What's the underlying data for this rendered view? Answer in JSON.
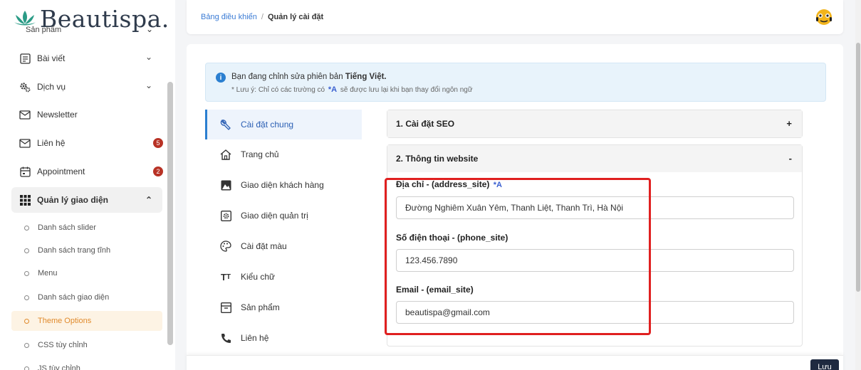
{
  "sidebar": {
    "logo_text": "Beautispa.",
    "partial_item": "Sản phẩm",
    "items": [
      {
        "label": "Bài viết",
        "icon": "article-icon"
      },
      {
        "label": "Dịch vụ",
        "icon": "gears-icon"
      },
      {
        "label": "Newsletter",
        "icon": "mail-icon"
      },
      {
        "label": "Liên hệ",
        "icon": "mail-icon",
        "badge": "5"
      },
      {
        "label": "Appointment",
        "icon": "calendar-icon",
        "badge": "2"
      },
      {
        "label": "Quản lý giao diện",
        "icon": "grid-icon"
      }
    ],
    "sub_items": [
      {
        "label": "Danh sách slider"
      },
      {
        "label": "Danh sách trang tĩnh"
      },
      {
        "label": "Menu"
      },
      {
        "label": "Danh sách giao diện"
      },
      {
        "label": "Theme Options"
      },
      {
        "label": "CSS tùy chỉnh"
      },
      {
        "label": "JS tùy chỉnh"
      }
    ]
  },
  "breadcrumb": {
    "parent": "Bảng điều khiển",
    "separator": "/",
    "current": "Quản lý cài đặt"
  },
  "notice": {
    "line1_prefix": "Bạn đang chỉnh sửa phiên bản",
    "line1_lang": "Tiếng Việt.",
    "line2_prefix": "* Lưu ý: Chỉ có các trường có",
    "line2_suffix": "sẽ được lưu lại khi bạn thay đổi ngôn ngữ"
  },
  "settings_tabs": [
    {
      "label": "Cài đặt chung",
      "icon": "wrench-icon"
    },
    {
      "label": "Trang chủ",
      "icon": "home-icon"
    },
    {
      "label": "Giao diện khách hàng",
      "icon": "image-icon"
    },
    {
      "label": "Giao diện quản trị",
      "icon": "dashboard-icon"
    },
    {
      "label": "Cài đặt màu",
      "icon": "palette-icon"
    },
    {
      "label": "Kiểu chữ",
      "icon": "text-icon"
    },
    {
      "label": "Sản phẩm",
      "icon": "box-icon"
    },
    {
      "label": "Liên hệ",
      "icon": "phone-icon"
    }
  ],
  "sections": {
    "seo": {
      "title": "1. Cài đặt SEO",
      "toggle": "+"
    },
    "website": {
      "title": "2. Thông tin website",
      "toggle": "-"
    }
  },
  "fields": {
    "address": {
      "label": "Địa chỉ - (address_site)",
      "value": "Đường Nghiêm Xuân Yêm, Thanh Liệt, Thanh Trì, Hà Nội"
    },
    "phone": {
      "label": "Số điện thoại - (phone_site)",
      "value": "123.456.7890"
    },
    "email": {
      "label": "Email - (email_site)",
      "value": "beautispa@gmail.com"
    }
  },
  "save_label": "Lưu",
  "colors": {
    "accent": "#2b7fd0",
    "active_orange": "#e08a2c",
    "badge_red": "#b83225",
    "highlight_red": "#e02020",
    "save_dark": "#1f2a40"
  }
}
